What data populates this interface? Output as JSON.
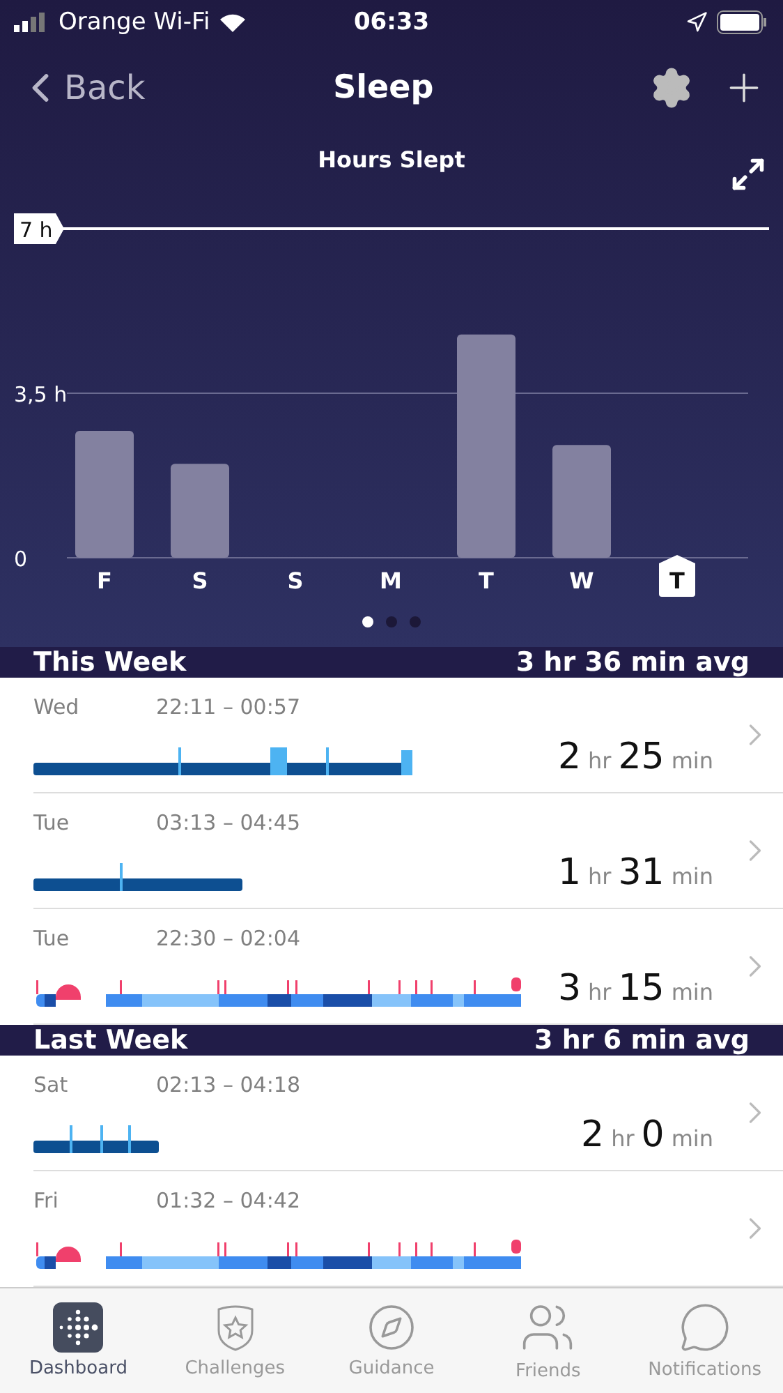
{
  "status_bar": {
    "carrier": "Orange Wi-Fi",
    "time": "06:33"
  },
  "nav": {
    "back": "Back",
    "title": "Sleep"
  },
  "chart": {
    "title": "Hours Slept",
    "category_selected": [
      false,
      false,
      false,
      false,
      false,
      false,
      true
    ],
    "chart_data": {
      "type": "bar",
      "categories": [
        "F",
        "S",
        "S",
        "M",
        "T",
        "W",
        "T"
      ],
      "values": [
        2.7,
        2.0,
        0,
        0,
        4.75,
        2.4,
        0
      ],
      "ylim": [
        0,
        7
      ],
      "yticks": [
        {
          "value": 0,
          "label": "0"
        },
        {
          "value": 3.5,
          "label": "3,5 h"
        },
        {
          "value": 7,
          "label": "7 h"
        }
      ]
    },
    "pages": [
      {
        "selected": true
      },
      {
        "selected": false
      },
      {
        "selected": false
      }
    ]
  },
  "sections": [
    {
      "title": "This Week",
      "average": "3 hr 36 min avg",
      "entries": [
        {
          "day": "Wed",
          "time": "22:11 – 00:57",
          "hours": "2",
          "hours_unit": "hr",
          "minutes": "25",
          "minutes_unit": "min",
          "kind": "classic"
        },
        {
          "day": "Tue",
          "time": "03:13 – 04:45",
          "hours": "1",
          "hours_unit": "hr",
          "minutes": "31",
          "minutes_unit": "min",
          "kind": "classic"
        },
        {
          "day": "Tue",
          "time": "22:30 – 02:04",
          "hours": "3",
          "hours_unit": "hr",
          "minutes": "15",
          "minutes_unit": "min",
          "kind": "stages"
        }
      ]
    },
    {
      "title": "Last Week",
      "average": "3 hr 6 min avg",
      "entries": [
        {
          "day": "Sat",
          "time": "02:13 – 04:18",
          "hours": "2",
          "hours_unit": "hr",
          "minutes": "0",
          "minutes_unit": "min",
          "kind": "classic"
        },
        {
          "day": "Fri",
          "time": "01:32 – 04:42",
          "kind": "stages"
        }
      ]
    }
  ],
  "tabs": [
    {
      "label": "Dashboard",
      "selected": true
    },
    {
      "label": "Challenges",
      "selected": false
    },
    {
      "label": "Guidance",
      "selected": false
    },
    {
      "label": "Friends",
      "selected": false
    },
    {
      "label": "Notifications",
      "selected": false
    }
  ]
}
